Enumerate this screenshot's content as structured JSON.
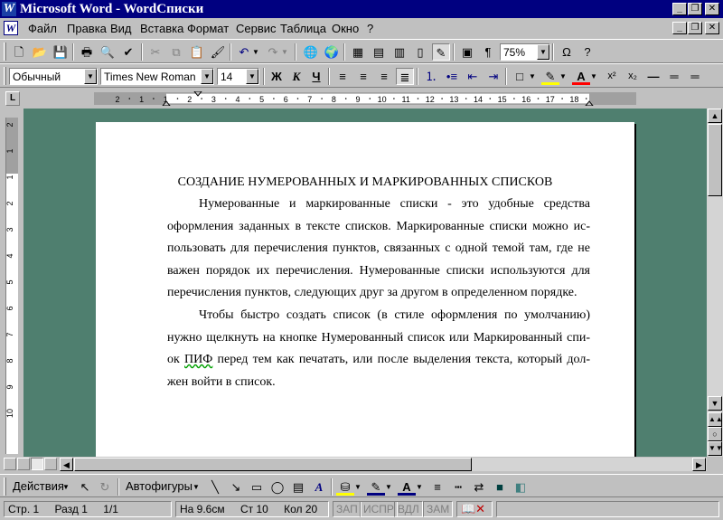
{
  "window": {
    "title": "Microsoft Word - WordСписки",
    "app_icon": "W",
    "buttons": {
      "minimize": "_",
      "maximize": "❐",
      "close": "✕"
    }
  },
  "menu": {
    "items": [
      {
        "label": "Файл"
      },
      {
        "label": "Правка"
      },
      {
        "label": "Вид"
      },
      {
        "label": "Вставка"
      },
      {
        "label": "Формат"
      },
      {
        "label": "Сервис"
      },
      {
        "label": "Таблица"
      },
      {
        "label": "Окно"
      },
      {
        "label": "?"
      }
    ]
  },
  "toolbar_standard": {
    "zoom": "75%",
    "paragraph_mark": "¶",
    "omega": "Ω",
    "help": "?"
  },
  "toolbar_format": {
    "style": "Обычный",
    "font": "Times New Roman",
    "size": "14",
    "bold": "Ж",
    "italic": "К",
    "underline": "Ч"
  },
  "ruler": {
    "marks": [
      "2",
      "1",
      "1",
      "2",
      "3",
      "4",
      "5",
      "6",
      "7",
      "8",
      "9",
      "10",
      "11",
      "12",
      "13",
      "14",
      "15",
      "16",
      "17",
      "18"
    ]
  },
  "document": {
    "heading": "СОЗДАНИЕ НУМЕРОВАННЫХ И МАРКИРОВАННЫХ СПИСКОВ",
    "paragraph1": [
      "Нумерованные и маркированные списки - это удобные средства",
      "оформления заданных в тексте списков. Маркированные списки можно ис-",
      "пользовать для перечисления пунктов, связанных с одной темой там, где не",
      "важен порядок их перечисления. Нумерованные списки используются для",
      "перечисления пунктов, следующих друг за другом в определенном порядке."
    ],
    "paragraph2": [
      "Чтобы быстро создать список (в стиле оформления по умолчанию)",
      "нужно щелкнуть на кнопке Нумерованный список или Маркированный спи-",
      "перед тем как печатать, или после выделения текста, который дол-",
      "жен войти в список."
    ],
    "p2_line3_prefix": "ок",
    "p2_line3_misspelled": "ПИФ"
  },
  "drawing_toolbar": {
    "actions": "Действия",
    "autoshapes": "Автофигуры"
  },
  "status": {
    "page": "Стр. 1",
    "section": "Разд 1",
    "pages": "1/1",
    "at": "На 9.6см",
    "line": "Ст 10",
    "col": "Кол 20",
    "rec": "ЗАП",
    "trk": "ИСПР",
    "ext": "ВДЛ",
    "ovr": "ЗАМ"
  }
}
